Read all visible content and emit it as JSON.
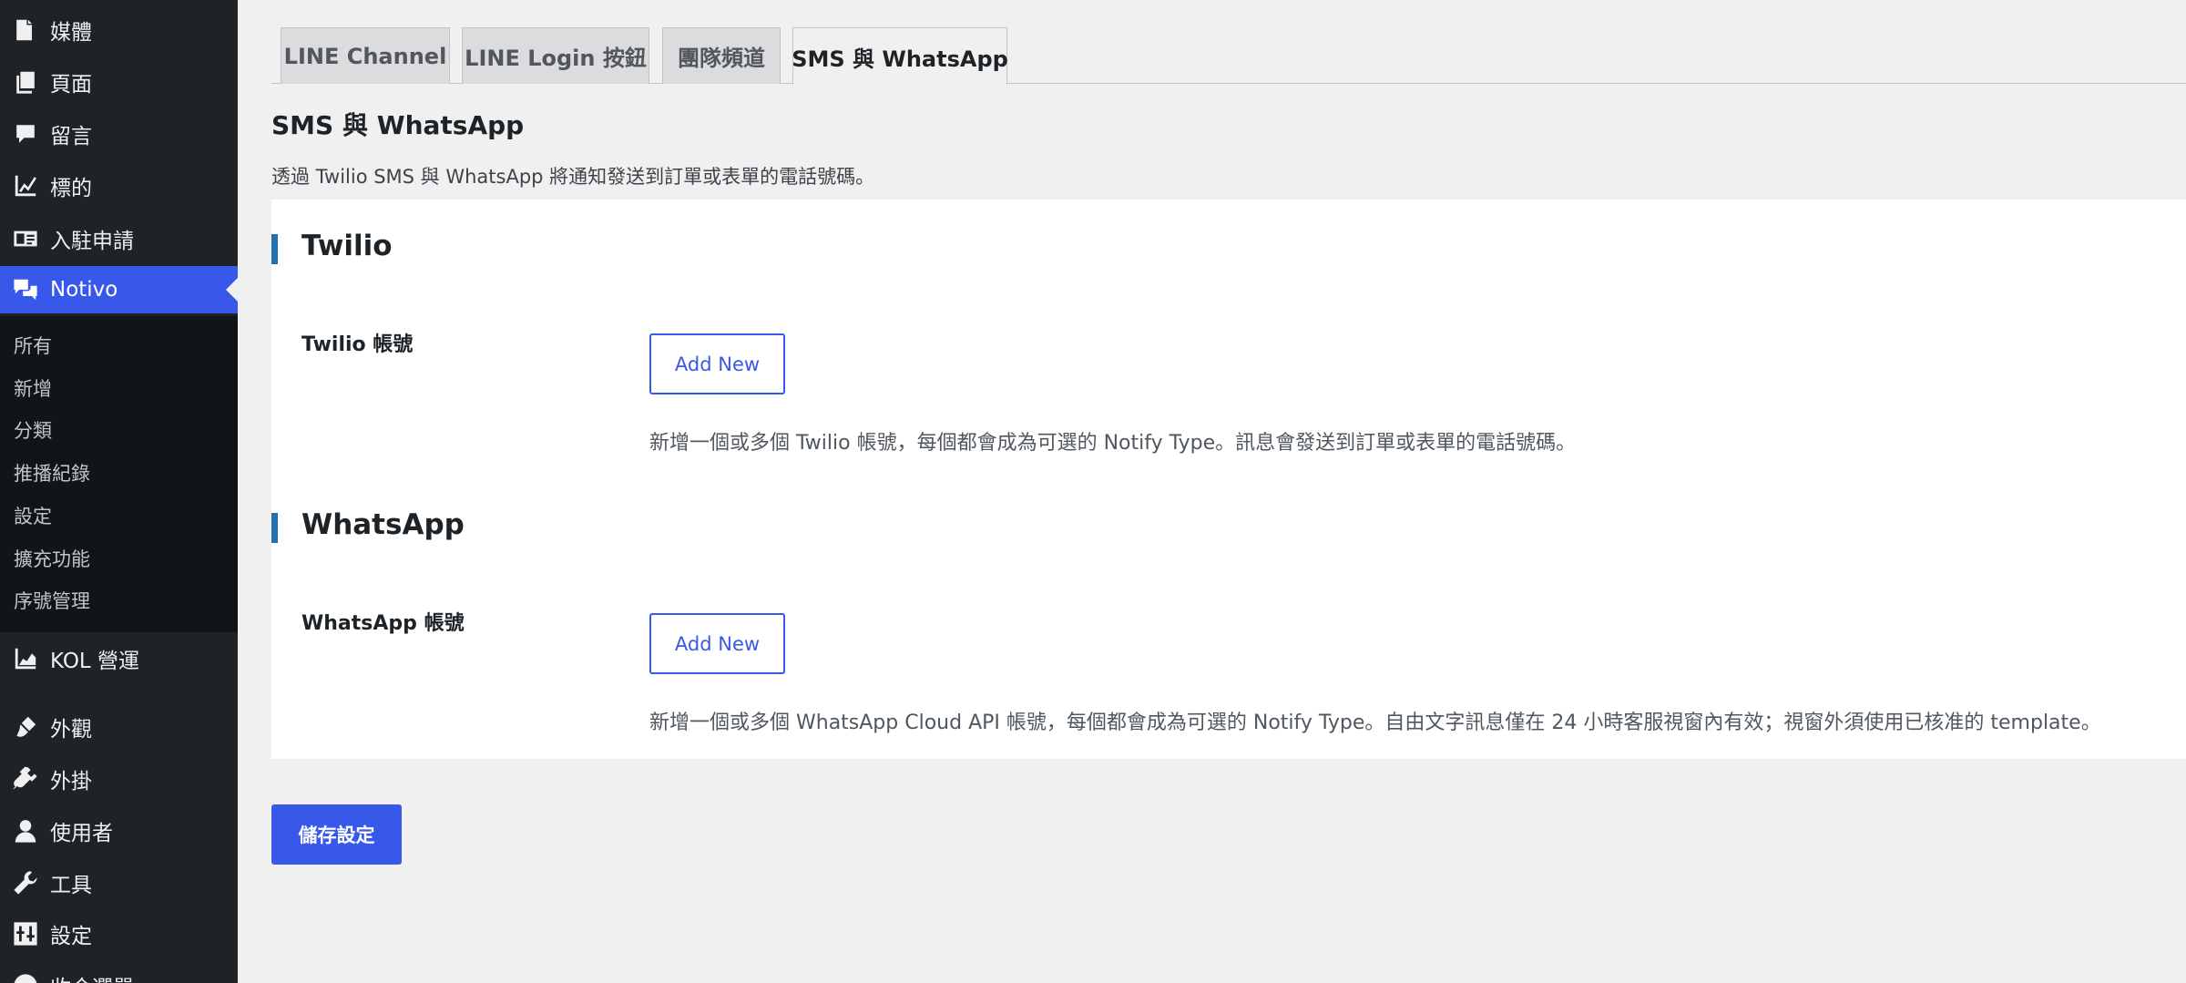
{
  "sidebar": {
    "items_top": [
      {
        "label": "媒體",
        "icon": "media-icon"
      },
      {
        "label": "頁面",
        "icon": "pages-icon"
      },
      {
        "label": "留言",
        "icon": "comments-icon"
      },
      {
        "label": "標的",
        "icon": "chart-line-icon"
      },
      {
        "label": "入駐申請",
        "icon": "id-card-icon"
      }
    ],
    "active_item": {
      "label": "Notivo",
      "icon": "chat-bubbles-icon"
    },
    "submenu": [
      "所有",
      "新增",
      "分類",
      "推播紀錄",
      "設定",
      "擴充功能",
      "序號管理"
    ],
    "items_bottom": [
      {
        "label": "KOL 營運",
        "icon": "chart-area-icon"
      },
      {
        "label": "外觀",
        "icon": "brush-icon"
      },
      {
        "label": "外掛",
        "icon": "plugin-icon"
      },
      {
        "label": "使用者",
        "icon": "user-icon"
      },
      {
        "label": "工具",
        "icon": "wrench-icon"
      },
      {
        "label": "設定",
        "icon": "settings-sliders-icon"
      },
      {
        "label": "收合選單",
        "icon": "collapse-icon"
      }
    ]
  },
  "tabs": [
    "LINE Channel",
    "LINE Login 按鈕",
    "團隊頻道",
    "SMS 與 WhatsApp"
  ],
  "page": {
    "heading": "SMS 與 WhatsApp",
    "description": "透過 Twilio SMS 與 WhatsApp 將通知發送到訂單或表單的電話號碼。"
  },
  "sections": [
    {
      "title": "Twilio",
      "field_label": "Twilio 帳號",
      "button_label": "Add New",
      "help": "新增一個或多個 Twilio 帳號，每個都會成為可選的 Notify Type。訊息會發送到訂單或表單的電話號碼。"
    },
    {
      "title": "WhatsApp",
      "field_label": "WhatsApp 帳號",
      "button_label": "Add New",
      "help": "新增一個或多個 WhatsApp Cloud API 帳號，每個都會成為可選的 Notify Type。自由文字訊息僅在 24 小時客服視窗內有效；視窗外須使用已核准的 template。"
    }
  ],
  "save_label": "儲存設定",
  "colors": {
    "accent": "#3858e9",
    "sidebar_bg": "#1d2327",
    "submenu_bg": "#101517",
    "section_bar": "#2271b1"
  }
}
